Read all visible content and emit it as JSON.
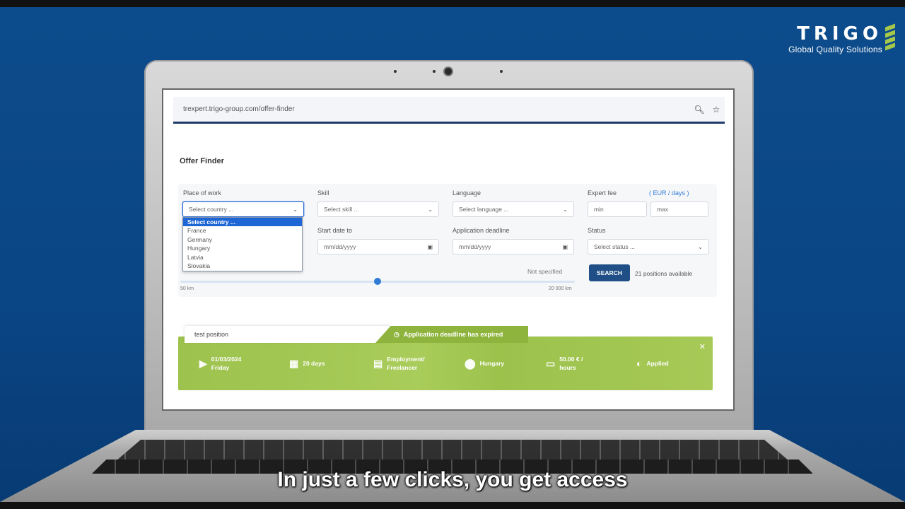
{
  "logo": {
    "word": "TRIGO",
    "tagline": "Global Quality Solutions"
  },
  "browser": {
    "url": "trexpert.trigo-group.com/offer-finder",
    "search_icon": "search-icon",
    "star_icon": "star-icon"
  },
  "page": {
    "title": "Offer Finder"
  },
  "filters": {
    "place_of_work": {
      "label": "Place of work",
      "value": "Select country ...",
      "options": [
        "Select country ...",
        "France",
        "Germany",
        "Hungary",
        "Latvia",
        "Slovakia"
      ]
    },
    "skill": {
      "label": "Skill",
      "value": "Select skill ..."
    },
    "language": {
      "label": "Language",
      "value": "Select language ..."
    },
    "expert_fee": {
      "label": "Expert fee",
      "unit": "( EUR / days )",
      "min_placeholder": "min",
      "max_placeholder": "max"
    },
    "start_date_to": {
      "label": "Start date to",
      "value": "mm/dd/yyyy"
    },
    "application_deadline": {
      "label": "Application deadline",
      "value": "mm/dd/yyyy"
    },
    "status": {
      "label": "Status",
      "value": "Select status ..."
    },
    "distance": {
      "value_label": "Not specified",
      "min_label": "50 km",
      "max_label": "20 000 km",
      "fraction": 0.5
    },
    "search_label": "SEARCH",
    "available": "21 positions available"
  },
  "result": {
    "title": "test position",
    "deadline_status": "Application deadline has expired",
    "start_date": "01/03/2024",
    "start_day": "Friday",
    "duration": "20 days",
    "employment_line1": "Employment/",
    "employment_line2": "Freelancer",
    "location": "Hungary",
    "fee_line1": "50.00 € /",
    "fee_line2": "hours",
    "status": "Applied"
  },
  "subtitle": "In just a few clicks, you get access"
}
